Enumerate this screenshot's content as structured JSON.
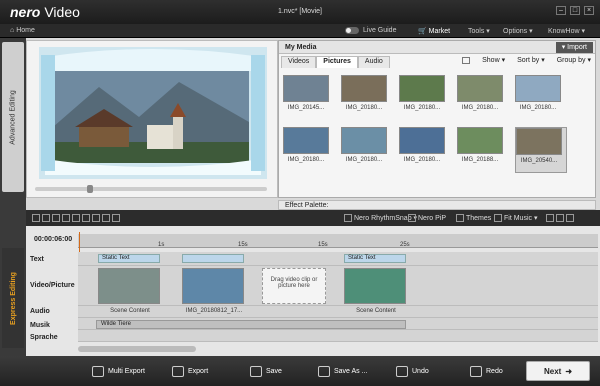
{
  "app": {
    "brand": "nero",
    "product": "Video",
    "window_title": "1.nvc* [Movie]"
  },
  "menubar": {
    "home": "Home",
    "live_guide": "Live Guide",
    "market": "Market",
    "tools": "Tools ▾",
    "options": "Options ▾",
    "knowhow": "KnowHow ▾"
  },
  "side_tabs": {
    "advanced": "Advanced Editing",
    "express": "Express Editing"
  },
  "media": {
    "title": "My Media",
    "import": "Import",
    "tabs": [
      "Videos",
      "Pictures",
      "Audio"
    ],
    "active_tab": "Pictures",
    "show": "Show ▾",
    "sort": "Sort by ▾",
    "group": "Group by ▾",
    "items": [
      {
        "label": "IMG_20145...",
        "color": "#6f8293"
      },
      {
        "label": "IMG_20180...",
        "color": "#7a6e5a"
      },
      {
        "label": "IMG_20180...",
        "color": "#5d7a4c"
      },
      {
        "label": "IMG_20180...",
        "color": "#7e8b6b"
      },
      {
        "label": "IMG_20180...",
        "color": "#8fa9c1"
      },
      {
        "label": "IMG_20180...",
        "color": "#587a9a"
      },
      {
        "label": "IMG_20180...",
        "color": "#6b8fa6"
      },
      {
        "label": "IMG_20180...",
        "color": "#4d6f96"
      },
      {
        "label": "IMG_20188...",
        "color": "#6d8d5e"
      },
      {
        "label": "IMG_20540...",
        "color": "#7c735f"
      }
    ]
  },
  "effect_palette": "Effect Palette:",
  "toolbar": {
    "rhythm": "Nero RhythmSnap ▾",
    "pip": "Nero PiP",
    "themes": "Themes",
    "fit_music": "Fit Music ▾"
  },
  "timeline": {
    "timecode": "00:00:06:00",
    "ticks": [
      "1s",
      "15s",
      "15s",
      "25s"
    ],
    "tracks": [
      "Text",
      "Video/Picture",
      "Audio",
      "Musik",
      "Sprache"
    ],
    "text_chip": "Static Text",
    "clips": [
      "Scene Content",
      "IMG_20180812_17...",
      "Scene Content"
    ],
    "drop_hint": "Drag video clip or picture here",
    "music": "Wilde Tiere"
  },
  "bottom": {
    "multi_export": "Multi Export",
    "export": "Export",
    "save": "Save",
    "save_as": "Save As ...",
    "undo": "Undo",
    "redo": "Redo",
    "next": "Next"
  }
}
